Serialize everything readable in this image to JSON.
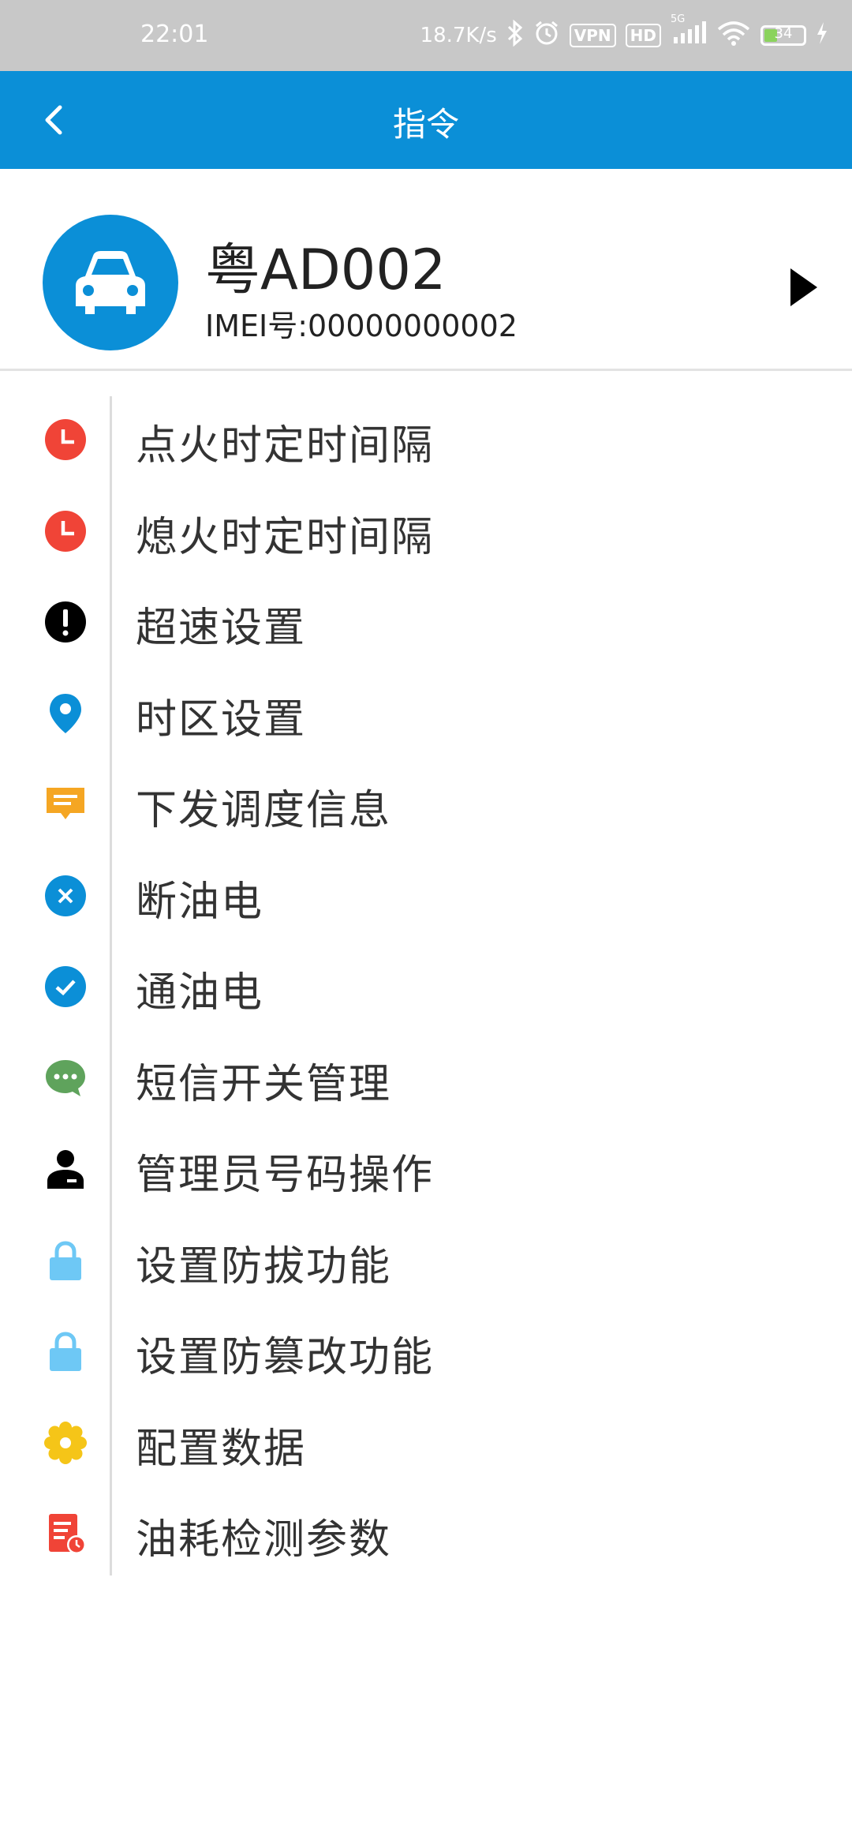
{
  "status_bar": {
    "time": "22:01",
    "net_speed": "18.7K/s",
    "vpn": "VPN",
    "hd": "HD",
    "signal_label": "5G",
    "battery": "34",
    "battery_level_percent": 34,
    "icons": [
      "bluetooth-icon",
      "alarm-icon",
      "signal-icon",
      "wifi-icon",
      "battery-icon",
      "charging-icon"
    ]
  },
  "app_bar": {
    "title": "指令",
    "back_icon": "chevron-left-icon"
  },
  "vehicle": {
    "plate": "粤AD002",
    "imei": "IMEI号:00000000002",
    "icon": "car-icon"
  },
  "colors": {
    "primary": "#0b8fd7",
    "red": "#f04437",
    "yellow_orange": "#f5a623",
    "green": "#5fa35c",
    "light_blue": "#6ec8f5",
    "yellow": "#f5c518"
  },
  "commands": [
    {
      "label": "点火时定时间隔",
      "icon": "clock-icon",
      "color": "#f04437"
    },
    {
      "label": "熄火时定时间隔",
      "icon": "clock-icon",
      "color": "#f04437"
    },
    {
      "label": "超速设置",
      "icon": "alert-icon",
      "color": "#000000"
    },
    {
      "label": "时区设置",
      "icon": "location-pin-icon",
      "color": "#0b8fd7"
    },
    {
      "label": "下发调度信息",
      "icon": "message-icon",
      "color": "#f5a623"
    },
    {
      "label": "断油电",
      "icon": "cross-circle-icon",
      "color": "#0b8fd7"
    },
    {
      "label": "通油电",
      "icon": "check-circle-icon",
      "color": "#0b8fd7"
    },
    {
      "label": "短信开关管理",
      "icon": "chat-bubble-icon",
      "color": "#5fa35c"
    },
    {
      "label": "管理员号码操作",
      "icon": "admin-user-icon",
      "color": "#000000"
    },
    {
      "label": "设置防拔功能",
      "icon": "lock-icon",
      "color": "#6ec8f5"
    },
    {
      "label": "设置防篡改功能",
      "icon": "lock-icon",
      "color": "#6ec8f5"
    },
    {
      "label": "配置数据",
      "icon": "gear-icon",
      "color": "#f5c518"
    },
    {
      "label": "油耗检测参数",
      "icon": "report-icon",
      "color": "#f04437"
    }
  ]
}
